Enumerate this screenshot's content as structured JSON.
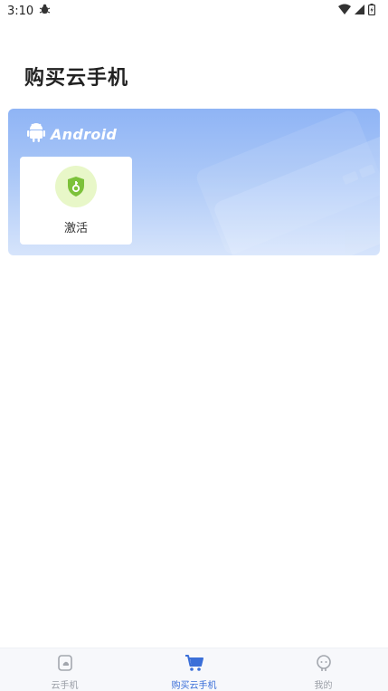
{
  "status_bar": {
    "time": "3:10",
    "icons": [
      "bug-icon",
      "wifi-icon",
      "signal-icon",
      "battery-icon"
    ]
  },
  "page": {
    "title": "购买云手机"
  },
  "android_card": {
    "brand": "Android",
    "tiles": [
      {
        "label": "激活",
        "icon": "shield-key-icon"
      }
    ]
  },
  "tab_bar": {
    "tabs": [
      {
        "label": "云手机",
        "icon": "cloud-phone-icon",
        "active": false
      },
      {
        "label": "购买云手机",
        "icon": "cart-icon",
        "active": true
      },
      {
        "label": "我的",
        "icon": "profile-icon",
        "active": false
      }
    ]
  },
  "colors": {
    "accent": "#3b6fd8",
    "card_gradient_top": "#8fb4f5",
    "card_gradient_bottom": "#d6e4fb",
    "activate_icon_bg": "#e8f7c8",
    "activate_icon_fg": "#7cc13a"
  }
}
